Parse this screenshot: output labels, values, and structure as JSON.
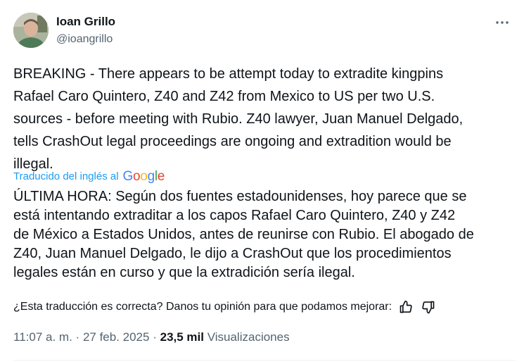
{
  "author": {
    "name": "Ioan Grillo",
    "handle": "@ioangrillo"
  },
  "tweet": {
    "text": "BREAKING - There appears to be attempt today to extradite kingpins\nRafael Caro Quintero, Z40 and Z42 from Mexico to US per two U.S.\nsources - before meeting with Rubio. Z40 lawyer, Juan Manuel Delgado,\ntells CrashOut legal proceedings are ongoing and extradition would be\nillegal."
  },
  "translation": {
    "label": "Traducido del inglés al",
    "provider": "Google",
    "text": "ÚLTIMA HORA: Según dos fuentes estadounidenses, hoy parece que se\nestá intentando extraditar a los capos Rafael Caro Quintero, Z40 y Z42\nde México a Estados Unidos, antes de reunirse con Rubio. El abogado de\nZ40, Juan Manuel Delgado, le dijo a CrashOut que los procedimientos\nlegales están en curso y que la extradición sería ilegal.",
    "feedback_question": "¿Esta traducción es correcta? Danos tu opinión para que podamos mejorar:"
  },
  "meta": {
    "time": "11:07 a. m.",
    "sep1": "·",
    "date": "27 feb. 2025",
    "sep2": "·",
    "views_count": "23,5 mil",
    "views_label": "Visualizaciones"
  },
  "icons": {
    "more": "more-horizontal-icon",
    "thumbs_up": "thumbs-up-icon",
    "thumbs_down": "thumbs-down-icon"
  },
  "colors": {
    "accent": "#1d9bf0",
    "secondary_text": "#536471",
    "primary_text": "#0f1419"
  }
}
